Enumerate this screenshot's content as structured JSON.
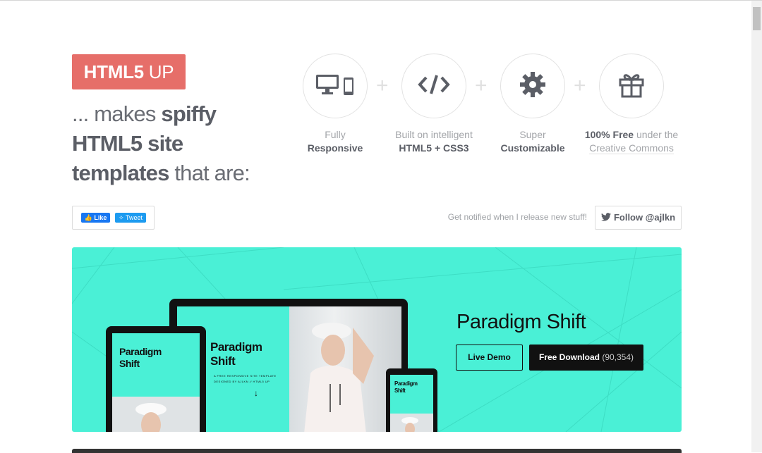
{
  "header": {
    "logo_bold": "HTML5",
    "logo_light": "UP",
    "tagline_pre": "... makes ",
    "tagline_bold": "spiffy HTML5 site templates",
    "tagline_post": " that are:"
  },
  "features": [
    {
      "icon": "responsive-devices-icon",
      "line1": "Fully",
      "line2": "Responsive"
    },
    {
      "icon": "code-icon",
      "line1": "Built on intelligent",
      "line2": "HTML5 + CSS3"
    },
    {
      "icon": "gear-icon",
      "line1": "Super",
      "line2": "Customizable"
    },
    {
      "icon": "gift-icon",
      "line1_bold": "100% Free",
      "line1_rest": " under the",
      "line2": "Creative Commons"
    }
  ],
  "social": {
    "like_label": "Like",
    "tweet_label": "Tweet",
    "notify_text": "Get notified when I release new stuff!",
    "follow_label": "Follow @ajlkn"
  },
  "featured_template": {
    "title": "Paradigm Shift",
    "live_demo_label": "Live Demo",
    "download_label": "Free Download",
    "download_count": "(90,354)",
    "preview_title_line1": "Paradigm",
    "preview_title_line2": "Shift",
    "preview_subtitle": "A FREE RESPONSIVE SITE TEMPLATE",
    "preview_credit": "DESIGNED BY AJLKN // HTML5 UP"
  },
  "colors": {
    "logo_bg": "#e66e69",
    "banner_bg": "#4af0d6",
    "facebook": "#1877f2",
    "twitter": "#1d9bf0"
  }
}
